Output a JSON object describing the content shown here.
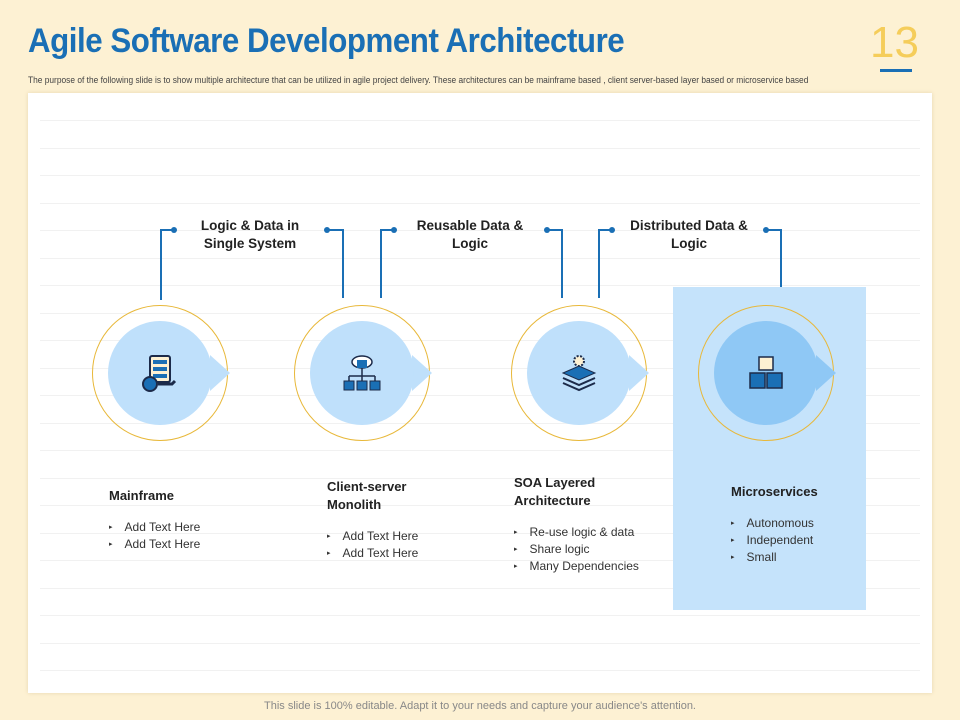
{
  "header": {
    "title": "Agile Software Development Architecture",
    "page_number": "13",
    "subtitle": "The purpose of the following slide is to show multiple architecture that can be utilized in agile project delivery. These architectures can be mainframe based , client server-based layer based or microservice based"
  },
  "connectors": [
    "Logic & Data in Single System",
    "Reusable Data & Logic",
    "Distributed Data & Logic"
  ],
  "items": [
    {
      "name": "Mainframe",
      "bullets": [
        "Add Text Here",
        "Add Text Here"
      ],
      "icon": "server-wrench-icon"
    },
    {
      "name": "Client-server Monolith",
      "bullets": [
        "Add Text Here",
        "Add Text Here"
      ],
      "icon": "cloud-network-icon"
    },
    {
      "name": "SOA Layered Architecture",
      "bullets": [
        "Re-use logic & data",
        "Share logic",
        "Many Dependencies"
      ],
      "icon": "layers-gear-icon"
    },
    {
      "name": "Microservices",
      "bullets": [
        "Autonomous",
        "Independent",
        "Small"
      ],
      "icon": "cubes-icon"
    }
  ],
  "footer": "This slide is 100% editable. Adapt it to your needs and capture your audience's attention.",
  "colors": {
    "accent": "#1a6fb5",
    "gold": "#e8b83a",
    "light_blue": "#bfe0fb"
  }
}
